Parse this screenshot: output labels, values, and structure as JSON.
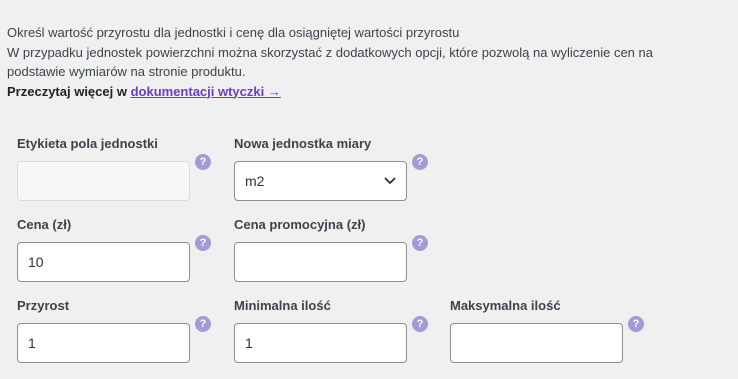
{
  "intro": {
    "line1": "Określ wartość przyrostu dla jednostki i cenę dla osiągniętej wartości przyrostu",
    "line2": "W przypadku jednostek powierzchni można skorzystać z dodatkowych opcji, które pozwolą na wyliczenie cen na podstawie wymiarów na stronie produktu.",
    "read_more": "Przeczytaj więcej w ",
    "link_text": "dokumentacji wtyczki →"
  },
  "help_glyph": "?",
  "fields": {
    "unit_label": {
      "label": "Etykieta pola jednostki",
      "value": ""
    },
    "new_unit": {
      "label": "Nowa jednostka miary",
      "value": "m2"
    },
    "price": {
      "label": "Cena (zł)",
      "value": "10"
    },
    "sale_price": {
      "label": "Cena promocyjna (zł)",
      "value": ""
    },
    "step": {
      "label": "Przyrost",
      "value": "1"
    },
    "min_qty": {
      "label": "Minimalna ilość",
      "value": "1"
    },
    "max_qty": {
      "label": "Maksymalna ilość",
      "value": ""
    }
  },
  "colors": {
    "help_icon": "#a39bd8",
    "link": "#6b3fc3",
    "background": "#f0f0f1"
  }
}
